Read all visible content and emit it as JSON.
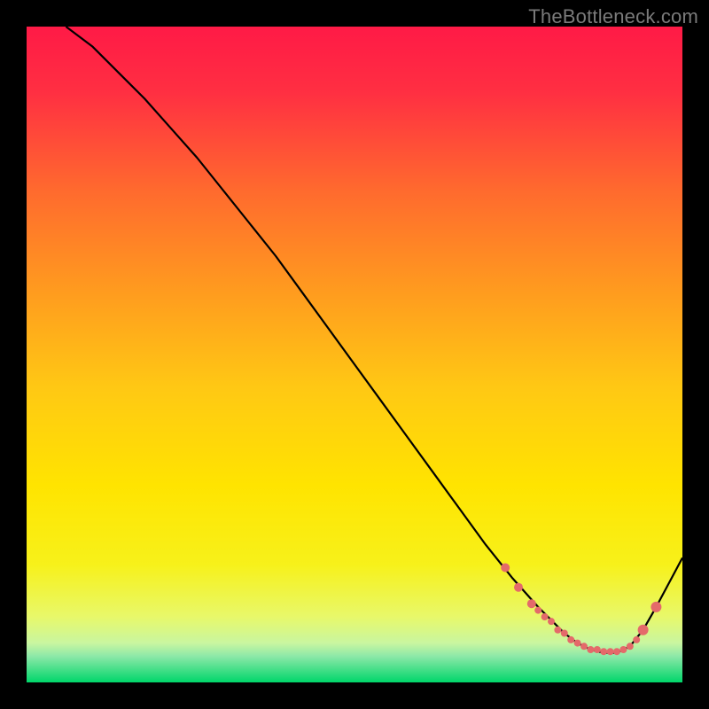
{
  "watermark": "TheBottleneck.com",
  "chart_data": {
    "type": "line",
    "title": "",
    "xlabel": "",
    "ylabel": "",
    "xlim": [
      0,
      100
    ],
    "ylim": [
      0,
      100
    ],
    "grid": false,
    "legend": false,
    "background": {
      "top_color": "#ff1a46",
      "mid_color": "#ffe400",
      "green_band": "#00d66a",
      "green_band_y_range": [
        0,
        6
      ]
    },
    "series": [
      {
        "name": "bottleneck-curve",
        "stroke": "#000000",
        "x": [
          6,
          10,
          14,
          18,
          22,
          26,
          30,
          34,
          38,
          42,
          46,
          50,
          54,
          58,
          62,
          66,
          70,
          74,
          78,
          80,
          82,
          84,
          86,
          88,
          90,
          92,
          94,
          96,
          100
        ],
        "values": [
          100,
          97,
          93,
          89,
          84.5,
          80,
          75,
          70,
          65,
          59.5,
          54,
          48.5,
          43,
          37.5,
          32,
          26.5,
          21,
          16,
          11.5,
          9.5,
          7.5,
          6,
          5,
          4.5,
          4.5,
          5.5,
          8,
          11.5,
          19
        ]
      }
    ],
    "markers": {
      "name": "optimal-range-dots",
      "color": "#e46a6a",
      "x": [
        73,
        75,
        77,
        78,
        79,
        80,
        81,
        82,
        83,
        84,
        85,
        86,
        87,
        88,
        89,
        90,
        91,
        92,
        93,
        94,
        96
      ],
      "values": [
        17.5,
        14.5,
        12,
        11,
        10,
        9.3,
        8,
        7.5,
        6.5,
        6,
        5.5,
        5,
        5,
        4.7,
        4.7,
        4.7,
        5,
        5.5,
        6.5,
        8,
        11.5
      ],
      "radius": [
        5,
        5,
        5,
        4,
        4,
        4,
        4,
        4,
        4,
        4,
        4,
        4,
        4,
        4,
        4,
        4,
        4,
        4,
        4,
        6,
        6
      ]
    }
  }
}
